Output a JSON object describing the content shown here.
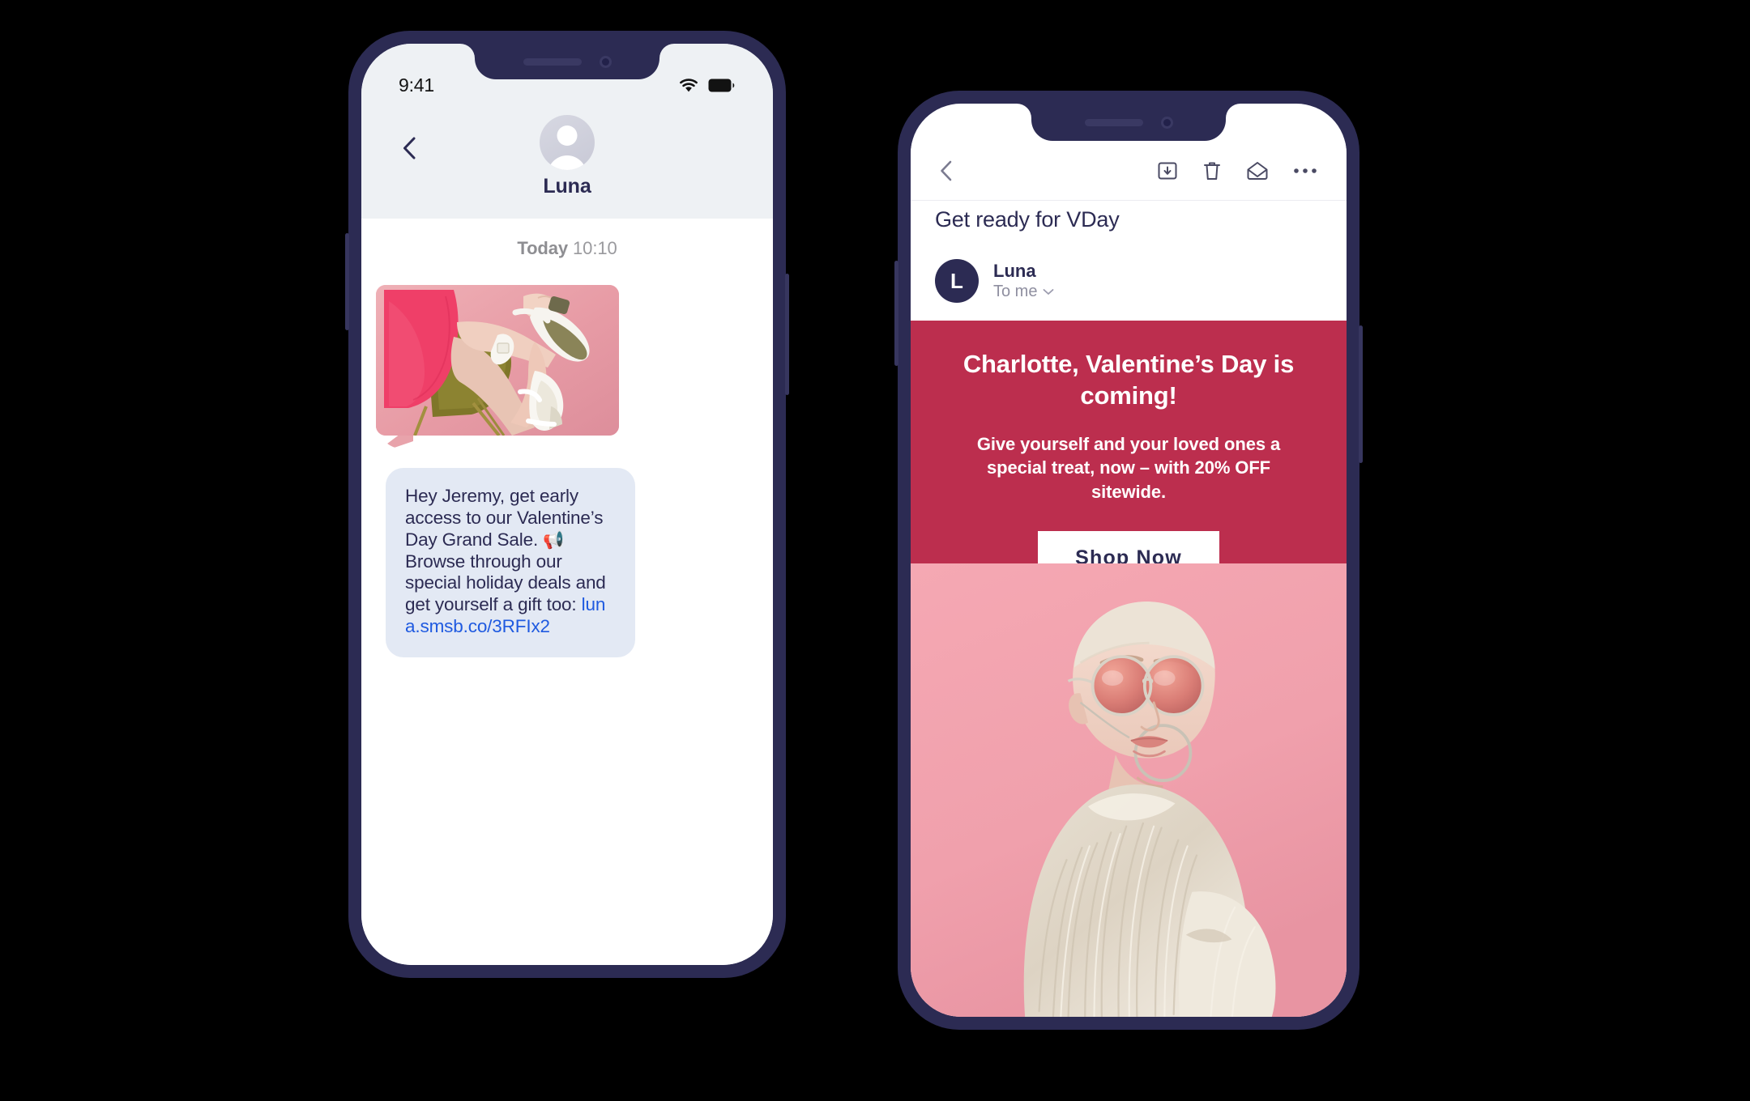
{
  "theme": {
    "frame_navy": "#2c2b53",
    "promo_red": "#bc2e4e",
    "bubble_blue": "#e3e9f4",
    "link_blue": "#1f5ae0",
    "header_grey": "#eef1f4",
    "photo_pink": "#f0a3ae"
  },
  "sms_phone": {
    "status_bar": {
      "time": "9:41",
      "wifi_icon": "wifi-icon",
      "battery_icon": "battery-full-icon"
    },
    "header": {
      "back_icon": "chevron-left-icon",
      "avatar_icon": "person-avatar-icon",
      "contact_name": "Luna"
    },
    "conversation": {
      "day_label": "Today",
      "time_label": "10:10",
      "image_message": {
        "alt": "woman in pink blouse fastening white heeled sandals on an olive chair against a pink backdrop"
      },
      "text_message": {
        "body": "Hey Jeremy, get early access to our Valentine’s Day Grand Sale. ",
        "emoji": "📢",
        "body_2": " Browse through our special holiday deals and get yourself a gift too: ",
        "link": "luna.smsb.co/3RFIx2"
      }
    }
  },
  "mail_phone": {
    "toolbar": {
      "back_icon": "chevron-left-icon",
      "archive_icon": "archive-icon",
      "delete_icon": "trash-icon",
      "unread_icon": "envelope-open-icon",
      "more_icon": "more-horizontal-icon"
    },
    "message": {
      "subject": "Get ready for VDay",
      "sender_initial": "L",
      "sender_name": "Luna",
      "recipient": "To me",
      "recipient_caret_icon": "chevron-down-icon"
    },
    "promo": {
      "headline": "Charlotte, Valentine’s Day is coming!",
      "subtext": "Give yourself and your loved ones a special treat, now – with 20% OFF sitewide.",
      "cta_label": "Shop Now"
    },
    "hero_image": {
      "alt": "model in a cream faux fur coat wearing round pink-tinted sunglasses and a hoop earring on a pink background"
    }
  }
}
